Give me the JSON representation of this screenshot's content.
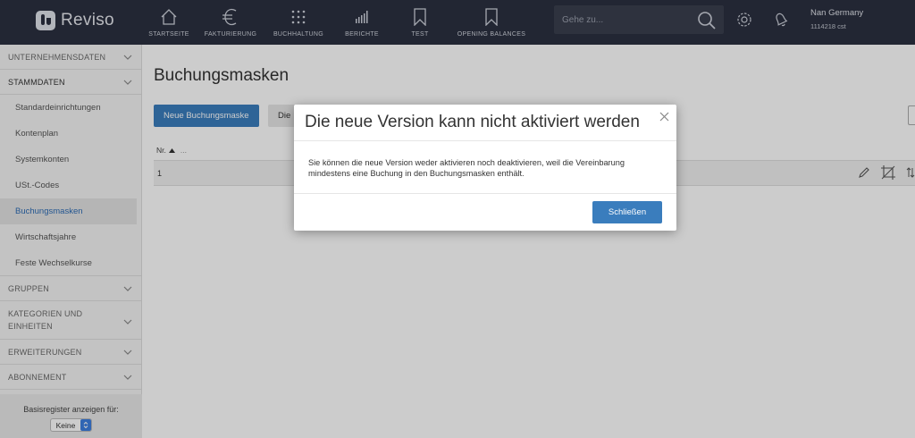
{
  "app": {
    "name": "Reviso"
  },
  "nav": [
    {
      "label": "STARTSEITE",
      "icon": "home-icon"
    },
    {
      "label": "FAKTURIERUNG",
      "icon": "euro-icon"
    },
    {
      "label": "BUCHHALTUNG",
      "icon": "grid-icon"
    },
    {
      "label": "BERICHTE",
      "icon": "bar-chart-icon"
    },
    {
      "label": "TEST",
      "icon": "bookmark-icon"
    },
    {
      "label": "OPENING BALANCES",
      "icon": "bookmark-icon"
    }
  ],
  "search": {
    "placeholder": "Gehe zu..."
  },
  "user": {
    "name": "Nan Germany",
    "account": "1114218 cst"
  },
  "sidebar": {
    "sections": {
      "unternehmensdaten": "UNTERNEHMENSDATEN",
      "stammdaten": "STAMMDATEN",
      "gruppen": "GRUPPEN",
      "kategorien_line1": "KATEGORIEN UND",
      "kategorien_line2": "EINHEITEN",
      "erweiterungen": "ERWEITERUNGEN",
      "abonnement": "ABONNEMENT"
    },
    "items": [
      "Standardeinrichtungen",
      "Kontenplan",
      "Systemkonten",
      "USt.-Codes",
      "Buchungsmasken",
      "Wirtschaftsjahre",
      "Feste Wechselkurse"
    ],
    "active_item": "Buchungsmasken",
    "filter_label": "Basisregister anzeigen für:",
    "filter_value": "Keine"
  },
  "main": {
    "title": "Buchungsmasken",
    "primary_button": "Neue Buchungsmaske",
    "secondary_button": "Die",
    "column_header": "Nr.",
    "column_dots": "...",
    "rows": [
      {
        "nr": "1"
      }
    ]
  },
  "modal": {
    "title": "Die neue Version kann nicht aktiviert werden",
    "body": "Sie können die neue Version weder aktivieren noch deaktivieren, weil die Vereinbarung mindestens eine Buchung in den Buchungsmasken enthält.",
    "button": "Schließen"
  },
  "colors": {
    "topbar": "#2b3040",
    "primary": "#3a7dbd",
    "active_link": "#2d6cb5"
  }
}
